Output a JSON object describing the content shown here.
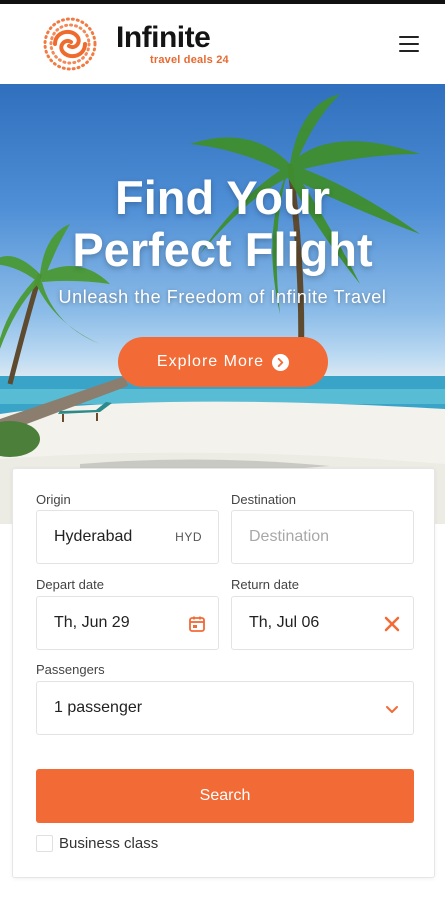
{
  "brand": {
    "name": "Infinite",
    "tagline": "travel deals 24",
    "accent": "#f26a35"
  },
  "nav": {
    "menu_icon": "hamburger-menu-icon"
  },
  "hero": {
    "title_line1": "Find Your",
    "title_line2": "Perfect Flight",
    "subtitle": "Unleash the Freedom of Infinite Travel",
    "cta_label": "Explore More",
    "cta_icon": "arrow-right-circle-icon"
  },
  "search": {
    "origin": {
      "label": "Origin",
      "value": "Hyderabad",
      "code": "HYD"
    },
    "destination": {
      "label": "Destination",
      "placeholder": "Destination",
      "value": ""
    },
    "depart": {
      "label": "Depart date",
      "value": "Th, Jun 29",
      "icon": "calendar-icon"
    },
    "return": {
      "label": "Return date",
      "value": "Th, Jul 06",
      "icon": "close-icon"
    },
    "passengers": {
      "label": "Passengers",
      "value": "1 passenger",
      "icon": "chevron-down-icon"
    },
    "submit_label": "Search",
    "business_class": {
      "label": "Business class",
      "checked": false
    }
  }
}
